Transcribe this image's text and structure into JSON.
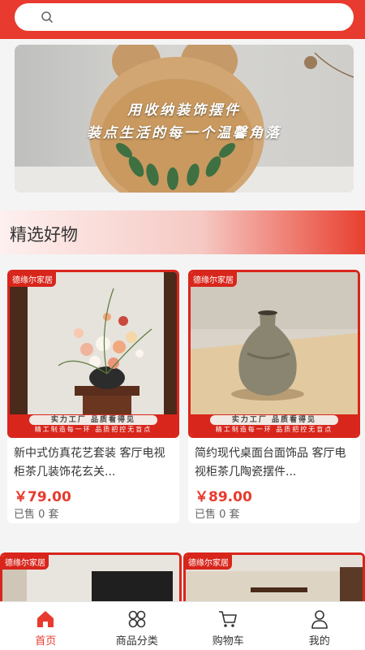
{
  "search": {
    "placeholder": ""
  },
  "banner": {
    "line1": "用收纳装饰摆件",
    "line2": "装点生活的每一个温馨角落",
    "slide_count": 2,
    "active_slide": 1
  },
  "section": {
    "title": "精选好物"
  },
  "products": [
    {
      "brand": "德缘尔家居",
      "tagline": "实力工厂 品质看得见",
      "subtag": "精工制造每一环 品质把控无盲点",
      "name": "新中式仿真花艺套装 客厅电视柜茶几装饰花玄关...",
      "price": "￥79.00",
      "sold": "已售 0 套"
    },
    {
      "brand": "德缘尔家居",
      "tagline": "实力工厂 品质看得见",
      "subtag": "精工制造每一环 品质把控无盲点",
      "name": "简约现代桌面台面饰品 客厅电视柜茶几陶瓷摆件...",
      "price": "￥89.00",
      "sold": "已售 0 套"
    },
    {
      "brand": "德缘尔家居"
    },
    {
      "brand": "德缘尔家居"
    }
  ],
  "tabs": [
    {
      "label": "首页",
      "icon": "home-icon",
      "active": true
    },
    {
      "label": "商品分类",
      "icon": "category-icon",
      "active": false
    },
    {
      "label": "购物车",
      "icon": "cart-icon",
      "active": false
    },
    {
      "label": "我的",
      "icon": "user-icon",
      "active": false
    }
  ],
  "colors": {
    "accent": "#e83a2e",
    "brand_red": "#d8261c"
  }
}
